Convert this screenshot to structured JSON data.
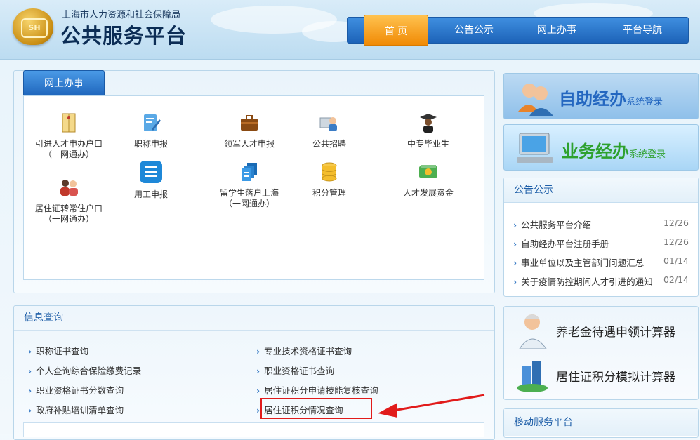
{
  "header": {
    "org_name": "上海市人力资源和社会保障局",
    "site_name": "公共服务平台",
    "emblem_text": "SH"
  },
  "nav": [
    "首 页",
    "公告公示",
    "网上办事",
    "平台导航"
  ],
  "online_services": {
    "tab_label": "网上办事",
    "items": [
      {
        "label": "引进人才申办户口\n（一网通办）",
        "icon": "document-envelope-icon"
      },
      {
        "label": "职称申报",
        "icon": "edit-form-icon"
      },
      {
        "label": "领军人才申报",
        "icon": "briefcase-icon"
      },
      {
        "label": "公共招聘",
        "icon": "recruitment-icon"
      },
      {
        "label": "中专毕业生",
        "icon": "graduate-icon"
      },
      {
        "label": "居住证转常住户口\n（一网通办）",
        "icon": "family-icon"
      },
      {
        "label": "用工申报",
        "icon": "list-icon"
      },
      {
        "label": "留学生落户上海\n（一网通办）",
        "icon": "documents-stack-icon"
      },
      {
        "label": "积分管理",
        "icon": "database-icon"
      },
      {
        "label": "人才发展资金",
        "icon": "money-icon"
      }
    ]
  },
  "info_query": {
    "title": "信息查询",
    "links": [
      "职称证书查询",
      "专业技术资格证书查询",
      "个人查询综合保险缴费记录",
      "职业资格证书查询",
      "职业资格证书分数查询",
      "居住证积分申请技能复核查询",
      "政府补贴培训清单查询",
      "居住证积分情况查询"
    ]
  },
  "banners": {
    "self_service": {
      "big": "自助经办",
      "small": "系统登录"
    },
    "business": {
      "big": "业务经办",
      "small": "系统登录"
    }
  },
  "notice": {
    "title": "公告公示",
    "items": [
      {
        "text": "公共服务平台介绍",
        "date": "12/26"
      },
      {
        "text": "自助经办平台注册手册",
        "date": "12/26"
      },
      {
        "text": "事业单位以及主管部门问题汇总",
        "date": "01/14"
      },
      {
        "text": "关于疫情防控期间人才引进的通知",
        "date": "02/14"
      }
    ]
  },
  "calculators": [
    "养老金待遇申领计算器",
    "居住证积分模拟计算器"
  ],
  "mobile": {
    "title": "移动服务平台"
  },
  "colors": {
    "nav_blue": "#1d63b8",
    "active_orange": "#f08a05",
    "highlight_red": "#e11b1b",
    "link_blue": "#1f5fa8"
  }
}
